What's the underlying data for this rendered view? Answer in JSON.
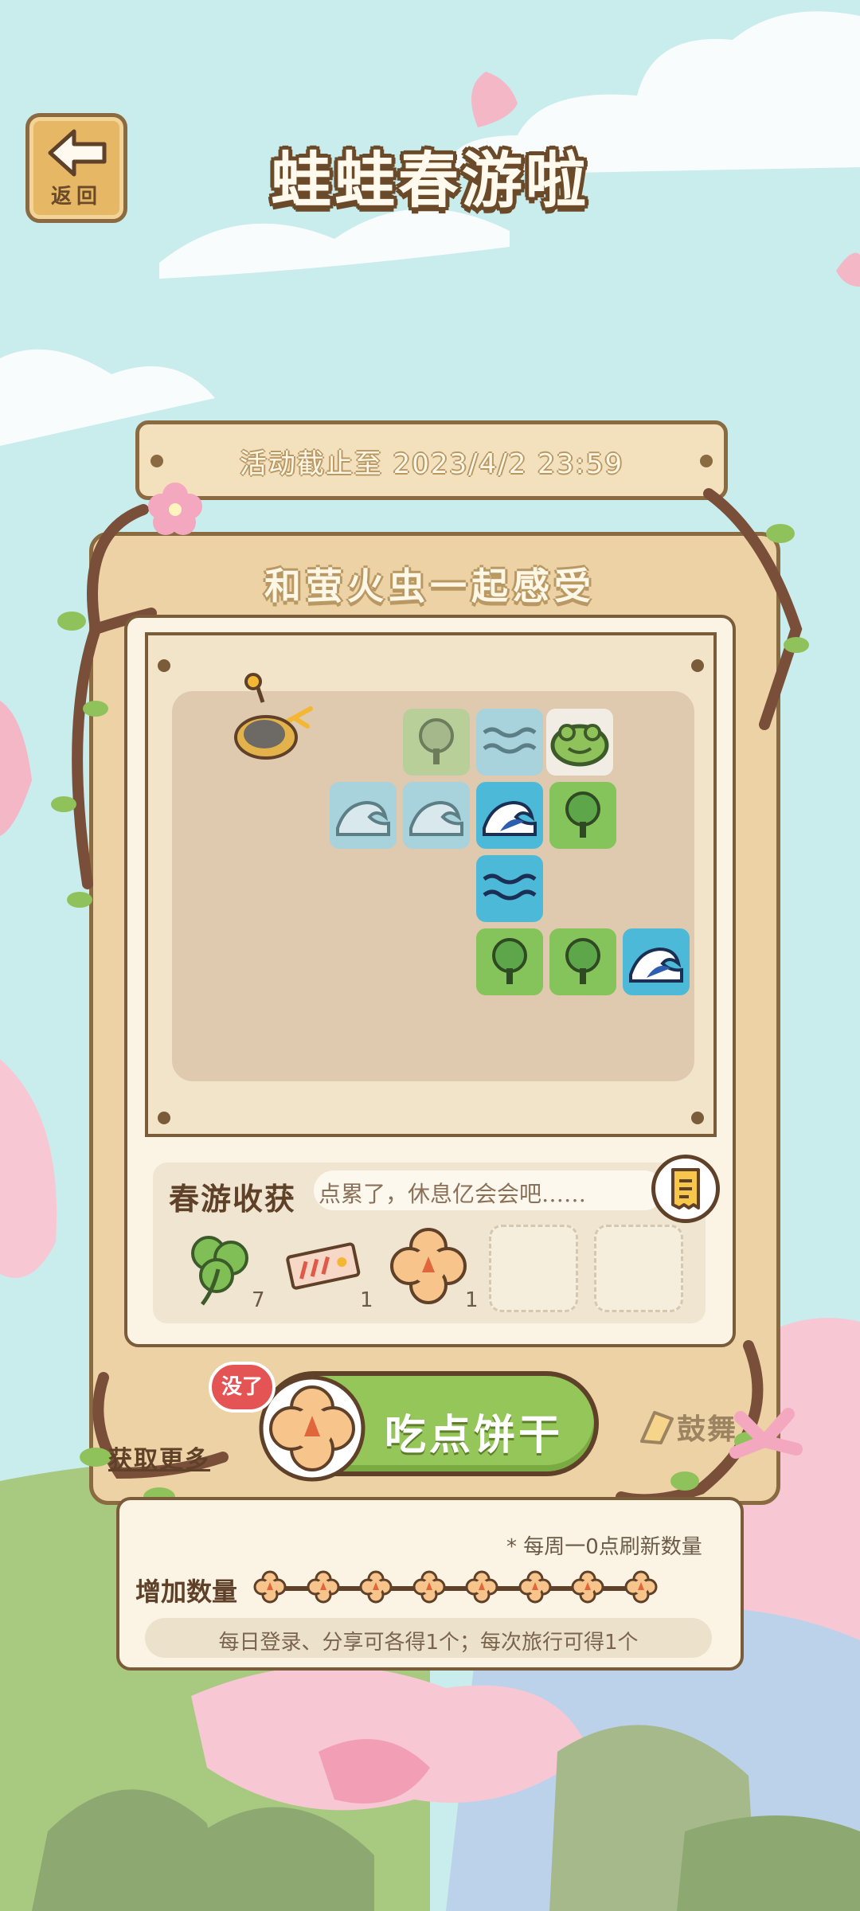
{
  "header": {
    "back_label": "返回",
    "title": "蛙蛙春游啦"
  },
  "event": {
    "deadline": "活动截止至 2023/4/2 23:59",
    "subtitle": "和萤火虫一起感受"
  },
  "harvest": {
    "title": "春游收获",
    "status": "点累了，休息亿会会吧……",
    "items": [
      {
        "icon": "clover-icon",
        "count": "7"
      },
      {
        "icon": "ticket-icon",
        "count": "1"
      },
      {
        "icon": "cookie-icon",
        "count": "1"
      }
    ],
    "empty_slots": 2
  },
  "actions": {
    "no_more_badge": "没了",
    "eat_button": "吃点饼干",
    "encourage": "鼓舞",
    "get_more": "获取更多"
  },
  "cookies": {
    "refresh_note": "* 每周一0点刷新数量",
    "add_label": "增加数量",
    "total": 8,
    "info": "每日登录、分享可各得1个；每次旅行可得1个"
  },
  "colors": {
    "sky": "#c9ecec",
    "wood": "#ecd2a4",
    "wood_border": "#8a6a40",
    "button_green": "#95c659",
    "badge_red": "#e55454",
    "tile_tree": "#84c45a",
    "tile_water": "#4db9d9"
  }
}
